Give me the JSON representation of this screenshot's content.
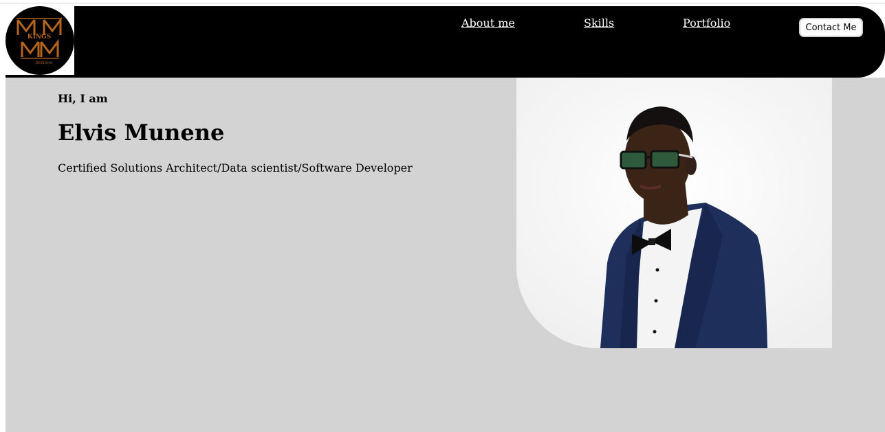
{
  "logo": {
    "alt": "Kings M Designs logo",
    "top_text": "KINGS",
    "bottom_text": "DESIGNS",
    "accent_color": "#b5651d"
  },
  "nav": {
    "links": [
      {
        "label": "About me"
      },
      {
        "label": "Skills"
      },
      {
        "label": "Portfolio"
      }
    ],
    "contact_label": "Contact Me"
  },
  "hero": {
    "greeting": "Hi, I am",
    "name": "Elvis Munene",
    "tagline": "Certified Solutions Architect/Data scientist/Software Developer",
    "background_color": "#d3d3d3"
  },
  "portrait": {
    "alt": "Portrait of a man in navy suit with bow tie and glasses"
  }
}
